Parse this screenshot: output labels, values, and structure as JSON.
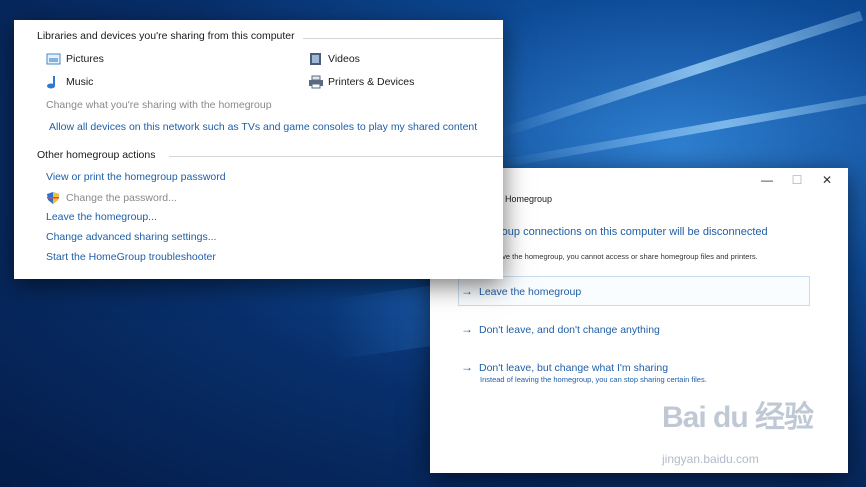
{
  "panel": {
    "libraries_heading": "Libraries and devices you're sharing from this computer",
    "items": [
      {
        "label": "Pictures",
        "icon": "pictures-icon"
      },
      {
        "label": "Videos",
        "icon": "videos-icon"
      },
      {
        "label": "Music",
        "icon": "music-icon"
      },
      {
        "label": "Printers & Devices",
        "icon": "printer-icon"
      }
    ],
    "change_sharing": "Change what you're sharing with the homegroup",
    "allow_devices": "Allow all devices on this network such as TVs and game consoles to play my shared content",
    "other_heading": "Other homegroup actions",
    "view_password": "View or print the homegroup password",
    "change_password": "Change the password...",
    "leave": "Leave the homegroup...",
    "advanced": "Change advanced sharing settings...",
    "troubleshooter": "Start the HomeGroup troubleshooter"
  },
  "dialog": {
    "title": "Homegroup",
    "heading": "roup connections on this computer will be disconnected",
    "description": "ave the homegroup, you cannot access or share homegroup files and printers.",
    "options": [
      {
        "label": "Leave the homegroup"
      },
      {
        "label": "Don't leave, and don't change anything"
      },
      {
        "label": "Don't leave, but change what I'm sharing",
        "sub": "Instead of leaving the homegroup, you can stop sharing certain files."
      }
    ],
    "minimize": "—",
    "maximize": "☐",
    "close": "✕"
  },
  "watermark": {
    "text": "Bai du 经验",
    "url": "jingyan.baidu.com"
  },
  "colors": {
    "link": "#1f5fa8",
    "desktop": "#0d4a96"
  }
}
